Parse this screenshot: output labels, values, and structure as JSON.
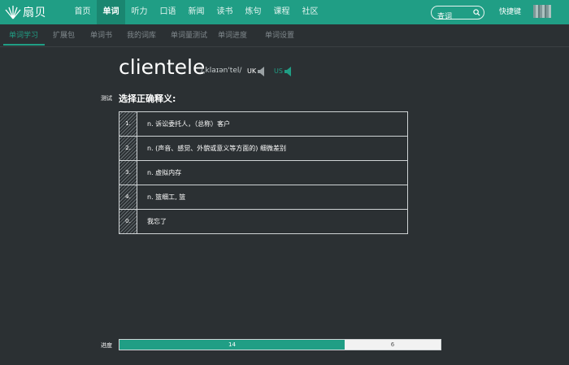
{
  "brand": {
    "name": "扇贝",
    "accent": "#209e85"
  },
  "nav": {
    "items": [
      {
        "label": "首页"
      },
      {
        "label": "单词",
        "active": true
      },
      {
        "label": "听力"
      },
      {
        "label": "口语"
      },
      {
        "label": "新闻"
      },
      {
        "label": "读书"
      },
      {
        "label": "炼句"
      },
      {
        "label": "课程"
      },
      {
        "label": "社区"
      }
    ],
    "search_placeholder": "查词",
    "shortcut": "快捷键"
  },
  "subnav": {
    "items": [
      {
        "label": "单词学习",
        "active": true
      },
      {
        "label": "扩展包"
      },
      {
        "label": "单词书"
      },
      {
        "label": "我的词库"
      },
      {
        "label": "单词量测试"
      },
      {
        "label": "单词进度"
      },
      {
        "label": "单词设置"
      }
    ]
  },
  "word": {
    "text": "clientele",
    "phonetic": "/ˌklaɪən'tel/",
    "uk": "UK",
    "us": "US"
  },
  "test": {
    "label": "测试",
    "prompt": "选择正确释义:",
    "options": [
      {
        "num": "1.",
        "text": "n. 诉讼委托人，（总称）客户"
      },
      {
        "num": "2.",
        "text": "n. (声音、感觉、外貌或意义等方面的) 细微差别"
      },
      {
        "num": "3.",
        "text": "n. 虚拟内存"
      },
      {
        "num": "4.",
        "text": "n. 篮细工, 篮"
      },
      {
        "num": "0.",
        "text": "我忘了"
      }
    ]
  },
  "progress": {
    "label": "进度",
    "done": "14",
    "remaining": "6",
    "done_fraction": 0.7
  }
}
